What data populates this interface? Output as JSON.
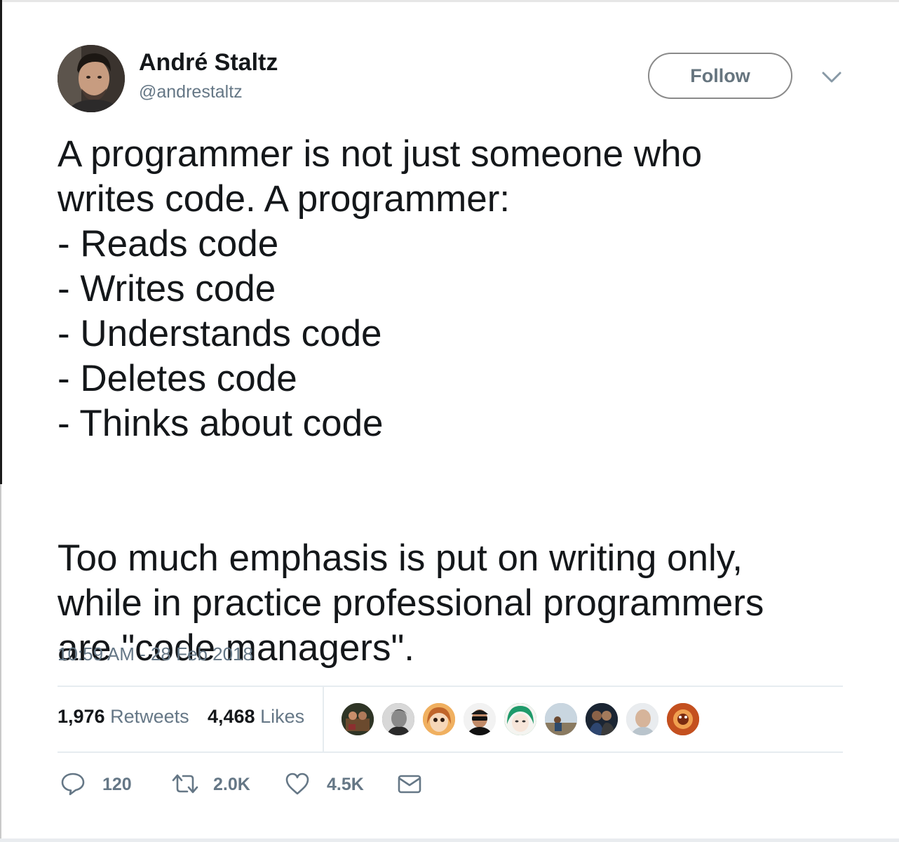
{
  "author": {
    "name": "André Staltz",
    "handle": "@andrestaltz"
  },
  "follow_label": "Follow",
  "tweet_lines": [
    "A programmer is not just someone who",
    "writes code. A programmer:",
    "- Reads code",
    "- Writes code",
    "- Understands code",
    "- Deletes code",
    "- Thinks about code",
    "",
    "Too much emphasis is put on writing only,",
    "while in practice professional programmers",
    "are \"code managers\"."
  ],
  "timestamp": "10:59 AM - 28 Feb 2018",
  "stats": {
    "retweets_count": "1,976",
    "retweets_label": "Retweets",
    "likes_count": "4,468",
    "likes_label": "Likes"
  },
  "actions": {
    "reply_count": "120",
    "retweet_count": "2.0K",
    "like_count": "4.5K"
  },
  "icons": [
    "avatar",
    "chevron-down-icon",
    "reply-icon",
    "retweet-icon",
    "heart-icon",
    "envelope-icon"
  ],
  "colors": {
    "text": "#14171a",
    "secondary": "#657786",
    "border": "#e6ecf0"
  }
}
